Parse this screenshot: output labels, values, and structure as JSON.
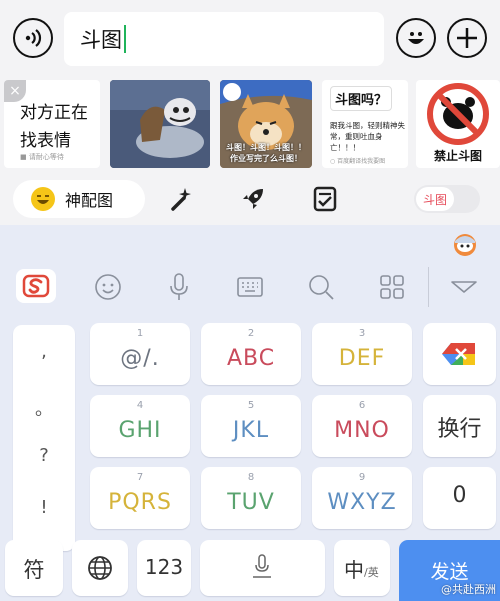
{
  "input": {
    "value": "斗图"
  },
  "stickers": {
    "searching_line1": "对方正在",
    "searching_line2": "找表情",
    "searching_small": "■ 请耐心等待",
    "close_symbol": "×",
    "dog_caption_line1": "斗图！斗图！斗图！！",
    "dog_caption_line2": "作业写完了么斗图！",
    "text_title": "斗图吗？",
    "text_body": "跟我斗图，轻则精神失常，重则吐血身亡！！！",
    "text_footer": "○ 百度翻译找我要图",
    "ban_label": "禁止斗图"
  },
  "features": {
    "shen_label": "神配图",
    "toggle_label": "斗图"
  },
  "keyboard": {
    "punct": [
      ",",
      "。",
      "?",
      "!"
    ],
    "keys": [
      {
        "num": "1",
        "letters": "@/.",
        "color": "#6d7480"
      },
      {
        "num": "2",
        "letters": "ABC",
        "color": "#c94b5c"
      },
      {
        "num": "3",
        "letters": "DEF",
        "color": "#d5b33a"
      },
      {
        "num": "4",
        "letters": "GHI",
        "color": "#5aa36f"
      },
      {
        "num": "5",
        "letters": "JKL",
        "color": "#5d8ec1"
      },
      {
        "num": "6",
        "letters": "MNO",
        "color": "#c94b5c"
      },
      {
        "num": "7",
        "letters": "PQRS",
        "color": "#d5b33a"
      },
      {
        "num": "8",
        "letters": "TUV",
        "color": "#5aa36f"
      },
      {
        "num": "9",
        "letters": "WXYZ",
        "color": "#5d8ec1"
      }
    ],
    "newline_label": "换行",
    "zero_label": "0",
    "symbol_label": "符",
    "num_label": "123",
    "lang_main": "中",
    "lang_sub": "/英",
    "send_label": "发送"
  },
  "watermark": "@共赴西洲"
}
